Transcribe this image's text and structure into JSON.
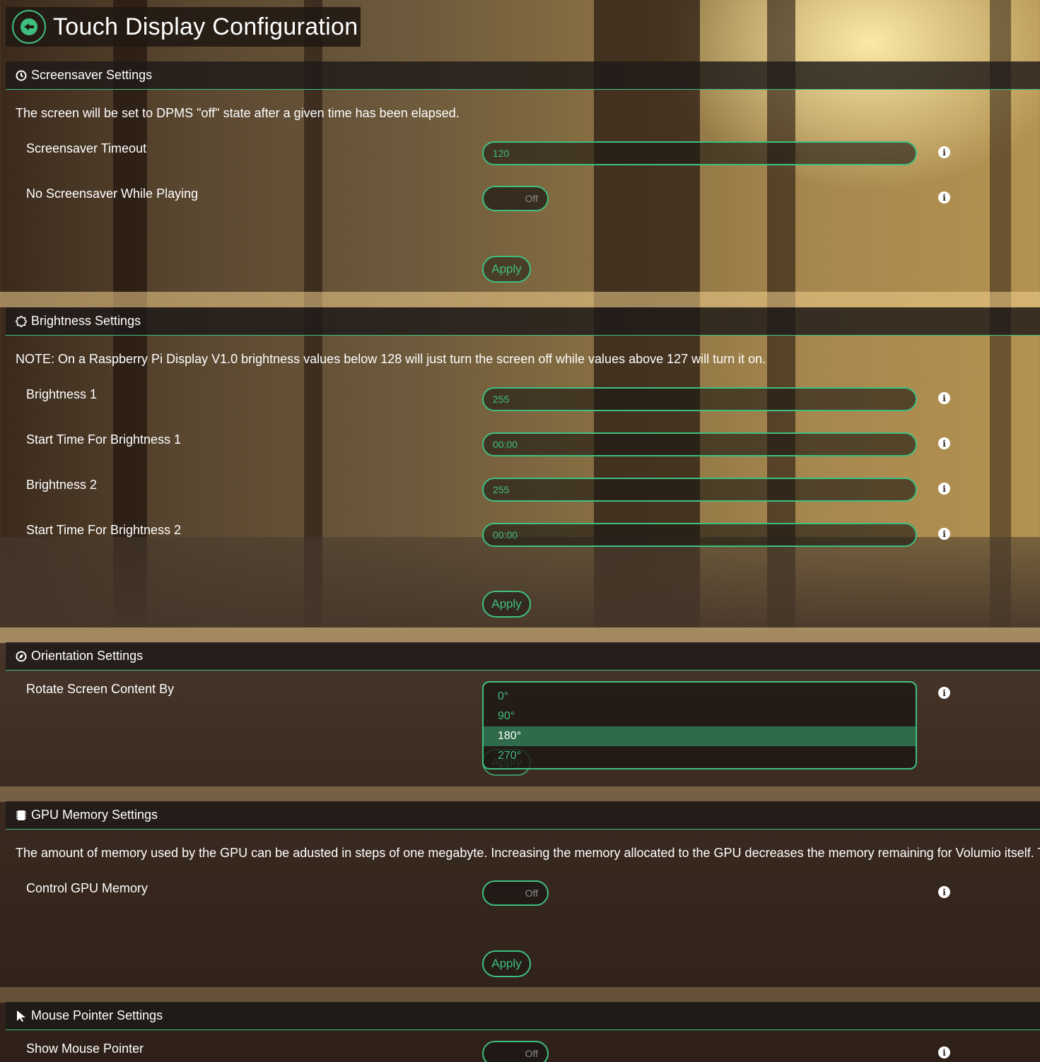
{
  "header": {
    "title": "Touch Display Configuration",
    "back_icon": "arrow-left-icon"
  },
  "screensaver": {
    "title": "Screensaver Settings",
    "icon": "clock-icon",
    "description": "The screen will be set to DPMS \"off\" state after a given time has been elapsed.",
    "timeout_label": "Screensaver Timeout",
    "timeout_value": "120",
    "no_screensaver_label": "No Screensaver While Playing",
    "no_screensaver_state": "Off",
    "apply": "Apply"
  },
  "brightness": {
    "title": "Brightness Settings",
    "icon": "sun-icon",
    "note": "NOTE: On a Raspberry Pi Display V1.0 brightness values below 128 will just turn the screen off while values above 127 will turn it on.",
    "b1_label": "Brightness 1",
    "b1_value": "255",
    "t1_label": "Start Time For Brightness 1",
    "t1_value": "00:00",
    "b2_label": "Brightness 2",
    "b2_value": "255",
    "t2_label": "Start Time For Brightness 2",
    "t2_value": "00:00",
    "apply": "Apply"
  },
  "orientation": {
    "title": "Orientation Settings",
    "icon": "compass-icon",
    "rotate_label": "Rotate Screen Content By",
    "options": [
      "0°",
      "90°",
      "180°",
      "270°"
    ],
    "selected": "180°",
    "apply": "Apply"
  },
  "gpu": {
    "title": "GPU Memory Settings",
    "icon": "memory-chip-icon",
    "description": "The amount of memory used by the GPU can be adusted in steps of one megabyte. Increasing the memory allocated to the GPU decreases the memory remaining for Volumio itself. This",
    "control_label": "Control GPU Memory",
    "control_state": "Off",
    "apply": "Apply"
  },
  "mouse": {
    "title": "Mouse Pointer Settings",
    "icon": "mouse-pointer-icon",
    "show_label": "Show Mouse Pointer",
    "show_state": "Off"
  },
  "info_glyph": "i",
  "colors": {
    "accent": "#3fbf7f",
    "header_bg": "#1e1a18",
    "selected_option": "#2f6b4a"
  }
}
